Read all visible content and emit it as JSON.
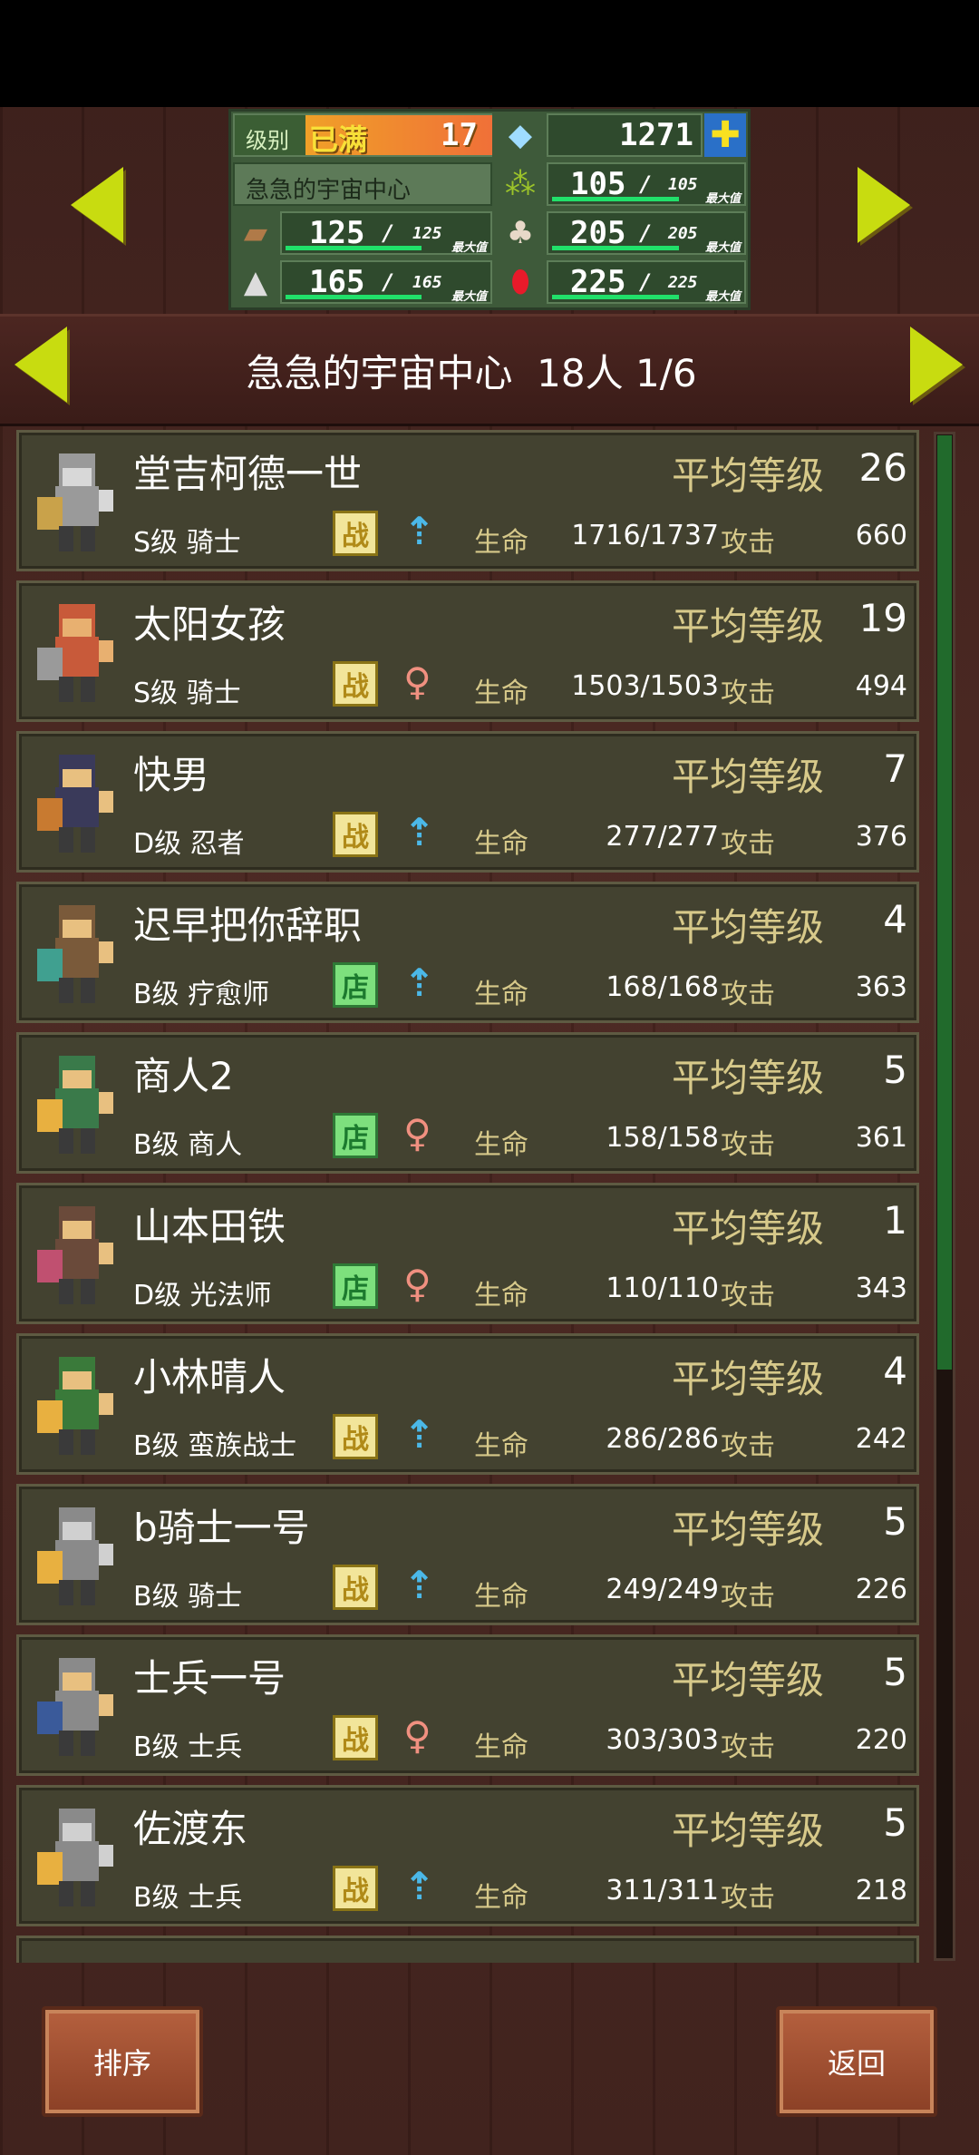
{
  "resources": {
    "level_label": "级别",
    "level_status": "已满",
    "level_value": "17",
    "gems": "1271",
    "town_name": "急急的宇宙中心",
    "max_label": "最大值",
    "grass": {
      "value": "105",
      "max": "105"
    },
    "wood": {
      "value": "125",
      "max": "125"
    },
    "food": {
      "value": "205",
      "max": "205"
    },
    "ore": {
      "value": "165",
      "max": "165"
    },
    "ruby": {
      "value": "225",
      "max": "225"
    }
  },
  "header": {
    "town": "急急的宇宙中心",
    "count": "18人",
    "page": "1/6"
  },
  "labels": {
    "avg_level": "平均等级",
    "hp": "生命",
    "atk": "攻击"
  },
  "members": [
    {
      "name": "堂吉柯德一世",
      "class": "S级 骑士",
      "tag": "战",
      "tag_type": "fight",
      "gender": "male",
      "level": "26",
      "hp": "1716/1737",
      "atk": "660"
    },
    {
      "name": "太阳女孩",
      "class": "S级 骑士",
      "tag": "战",
      "tag_type": "fight",
      "gender": "female",
      "level": "19",
      "hp": "1503/1503",
      "atk": "494"
    },
    {
      "name": "快男",
      "class": "D级 忍者",
      "tag": "战",
      "tag_type": "fight",
      "gender": "male",
      "level": "7",
      "hp": "277/277",
      "atk": "376"
    },
    {
      "name": "迟早把你辞职",
      "class": "B级 疗愈师",
      "tag": "店",
      "tag_type": "shop",
      "gender": "male",
      "level": "4",
      "hp": "168/168",
      "atk": "363"
    },
    {
      "name": "商人2",
      "class": "B级 商人",
      "tag": "店",
      "tag_type": "shop",
      "gender": "female",
      "level": "5",
      "hp": "158/158",
      "atk": "361"
    },
    {
      "name": "山本田铁",
      "class": "D级 光法师",
      "tag": "店",
      "tag_type": "shop",
      "gender": "female",
      "level": "1",
      "hp": "110/110",
      "atk": "343"
    },
    {
      "name": "小林晴人",
      "class": "B级 蛮族战士",
      "tag": "战",
      "tag_type": "fight",
      "gender": "male",
      "level": "4",
      "hp": "286/286",
      "atk": "242"
    },
    {
      "name": "b骑士一号",
      "class": "B级 骑士",
      "tag": "战",
      "tag_type": "fight",
      "gender": "male",
      "level": "5",
      "hp": "249/249",
      "atk": "226"
    },
    {
      "name": "士兵一号",
      "class": "B级 士兵",
      "tag": "战",
      "tag_type": "fight",
      "gender": "female",
      "level": "5",
      "hp": "303/303",
      "atk": "220"
    },
    {
      "name": "佐渡东",
      "class": "B级 士兵",
      "tag": "战",
      "tag_type": "fight",
      "gender": "male",
      "level": "5",
      "hp": "311/311",
      "atk": "218"
    }
  ],
  "buttons": {
    "sort": "排序",
    "back": "返回"
  },
  "colors": {
    "arrow": "#c8dc10",
    "avg_label": "#d7c98a",
    "male": "#4bb8e8",
    "female": "#f09080"
  }
}
